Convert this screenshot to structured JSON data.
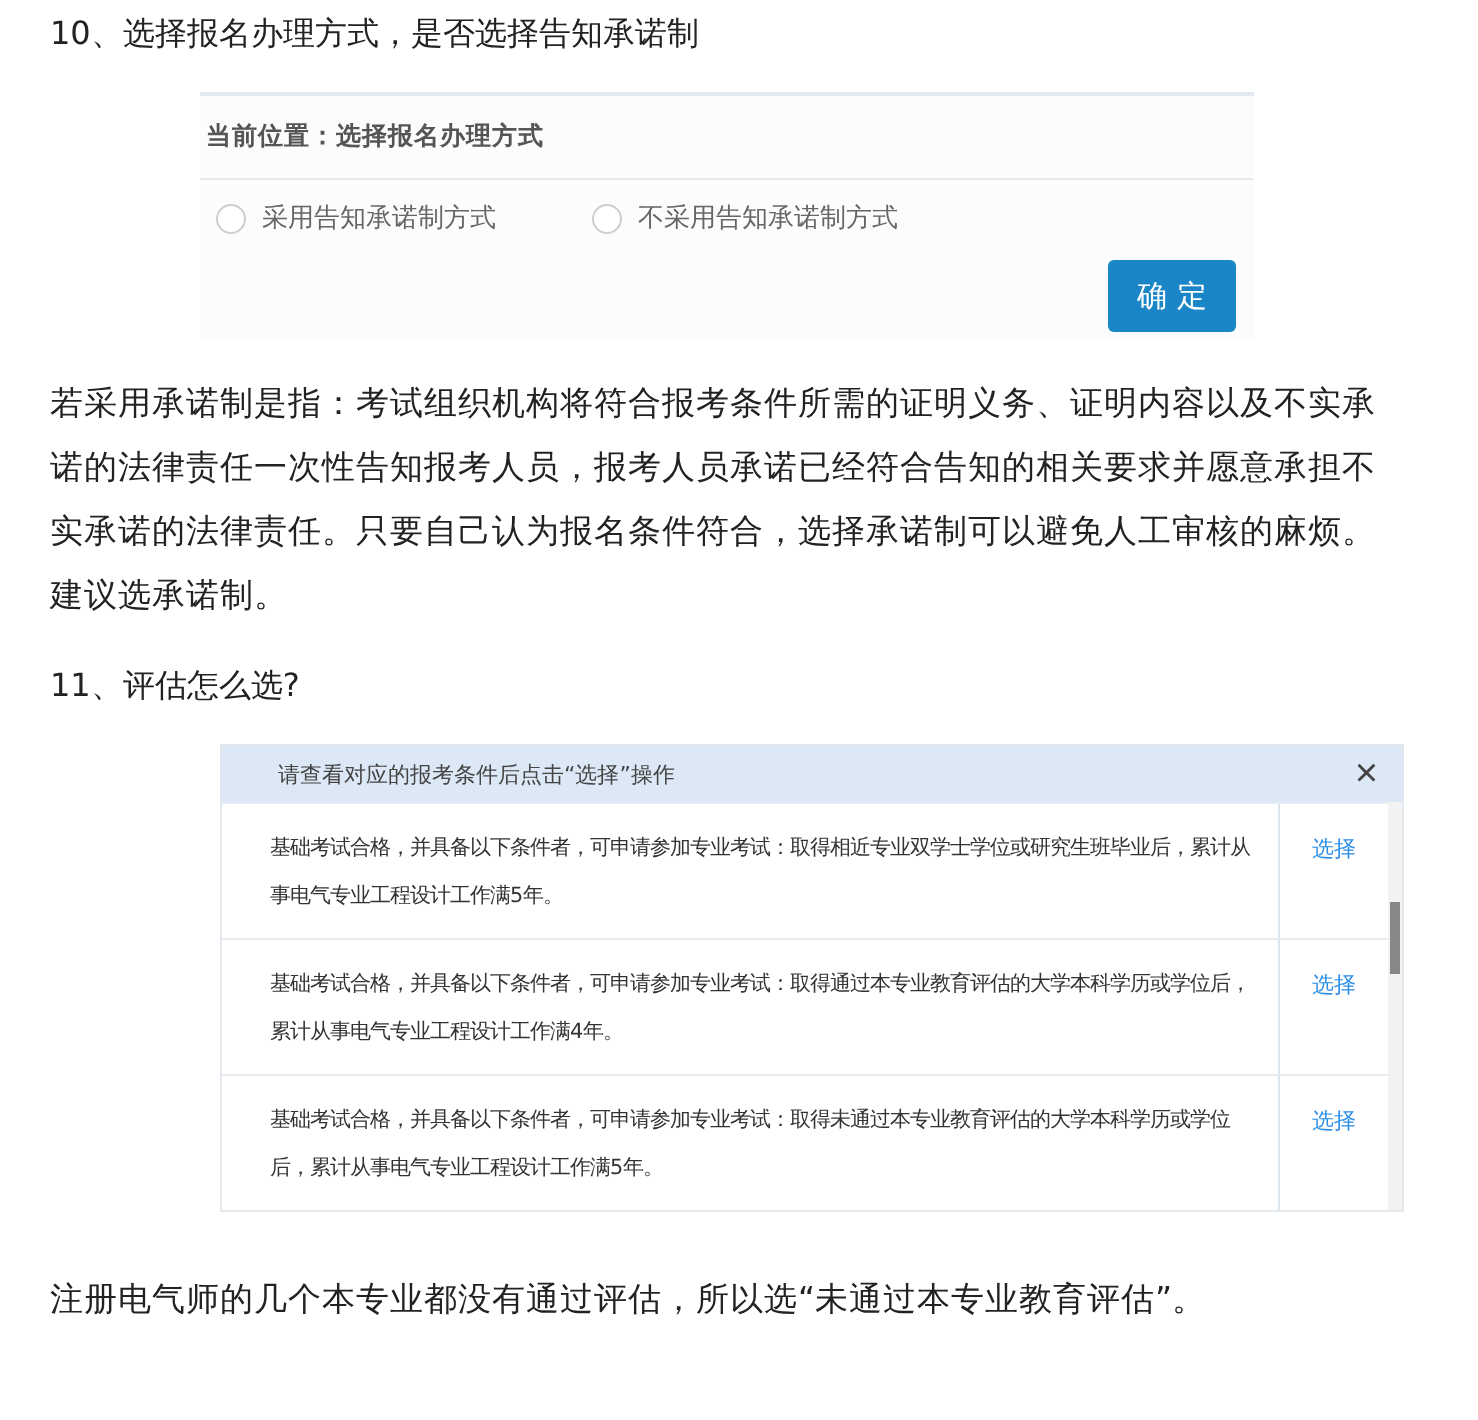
{
  "step10": {
    "heading": "10、选择报名办理方式，是否选择告知承诺制",
    "dialog": {
      "location": "当前位置：选择报名办理方式",
      "options": [
        {
          "label": "采用告知承诺制方式",
          "selected": false
        },
        {
          "label": "不采用告知承诺制方式",
          "selected": false
        }
      ],
      "confirm": "确 定"
    },
    "paragraph": "若采用承诺制是指：考试组织机构将符合报考条件所需的证明义务、证明内容以及不实承诺的法律责任一次性告知报考人员，报考人员承诺已经符合告知的相关要求并愿意承担不实承诺的法律责任。只要自己认为报名条件符合，选择承诺制可以避免人工审核的麻烦。建议选承诺制。"
  },
  "step11": {
    "heading": "11、评估怎么选?",
    "dialog": {
      "title": "请查看对应的报考条件后点击“选择”操作",
      "close": "×",
      "rows": [
        {
          "text": "基础考试合格，并具备以下条件者，可申请参加专业考试：取得相近专业双学士学位或研究生班毕业后，累计从事电气专业工程设计工作满5年。",
          "action": "选择"
        },
        {
          "text": "基础考试合格，并具备以下条件者，可申请参加专业考试：取得通过本专业教育评估的大学本科学历或学位后，累计从事电气专业工程设计工作满4年。",
          "action": "选择"
        },
        {
          "text": "基础考试合格，并具备以下条件者，可申请参加专业考试：取得未通过本专业教育评估的大学本科学历或学位后，累计从事电气专业工程设计工作满5年。",
          "action": "选择"
        }
      ]
    },
    "paragraph": "注册电气师的几个本专业都没有通过评估，所以选“未通过本专业教育评估”。"
  }
}
